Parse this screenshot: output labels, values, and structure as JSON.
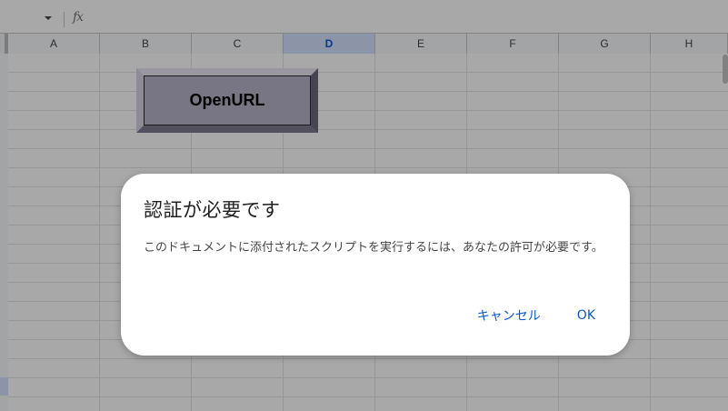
{
  "formula_bar": {
    "fx_label": "fx"
  },
  "columns": [
    {
      "label": "A",
      "active": false
    },
    {
      "label": "B",
      "active": false
    },
    {
      "label": "C",
      "active": false
    },
    {
      "label": "D",
      "active": true
    },
    {
      "label": "E",
      "active": false
    },
    {
      "label": "F",
      "active": false
    },
    {
      "label": "G",
      "active": false
    },
    {
      "label": "H",
      "active": false
    }
  ],
  "sheet_button": {
    "label": "OpenURL"
  },
  "dialog": {
    "title": "認証が必要です",
    "message": "このドキュメントに添付されたスクリプトを実行するには、あなたの許可が必要です。",
    "cancel_label": "キャンセル",
    "ok_label": "OK"
  },
  "colors": {
    "accent": "#0b57d0",
    "active_column": "#d3e3fd"
  }
}
